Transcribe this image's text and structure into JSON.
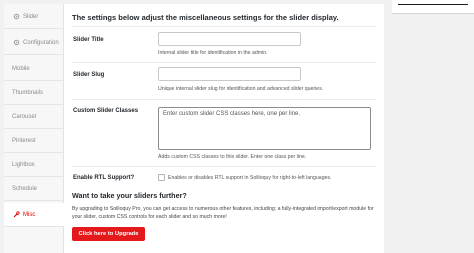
{
  "sidebar": {
    "items": [
      {
        "label": "Slider",
        "icon": "gear-icon"
      },
      {
        "label": "Configuration",
        "icon": "gear-icon"
      },
      {
        "label": "Mobile",
        "icon": ""
      },
      {
        "label": "Thumbnails",
        "icon": ""
      },
      {
        "label": "Carousel",
        "icon": ""
      },
      {
        "label": "Pinterest",
        "icon": ""
      },
      {
        "label": "Lightbox",
        "icon": ""
      },
      {
        "label": "Schedule",
        "icon": ""
      },
      {
        "label": "Misc",
        "icon": "wrench-icon",
        "active": true
      }
    ]
  },
  "main": {
    "heading": "The settings below adjust the miscellaneous settings for the slider display.",
    "fields": {
      "title": {
        "label": "Slider Title",
        "value": "",
        "help": "Internal slider title for identification in the admin."
      },
      "slug": {
        "label": "Slider Slug",
        "value": "",
        "help": "Unique internal slider slug for identification and advanced slider queries."
      },
      "classes": {
        "label": "Custom Slider Classes",
        "placeholder": "Enter custom slider CSS classes here, one per line.",
        "help": "Adds custom CSS classes to this slider. Enter one class per line."
      },
      "rtl": {
        "label": "Enable RTL Support?",
        "checked": false,
        "help": "Enables or disables RTL support in Soliloquy for right-to-left languages."
      }
    },
    "promo": {
      "title": "Want to take your sliders further?",
      "text": "By upgrading to Soliloquy Pro, you can get access to numerous other features, including: a fully-integrated import/export module for your slider, custom CSS controls for each slider and so much more!",
      "button_label": "Click here to Upgrade"
    }
  },
  "colors": {
    "accent": "#e3191b",
    "active_sidebar_text": "#dd0000"
  }
}
